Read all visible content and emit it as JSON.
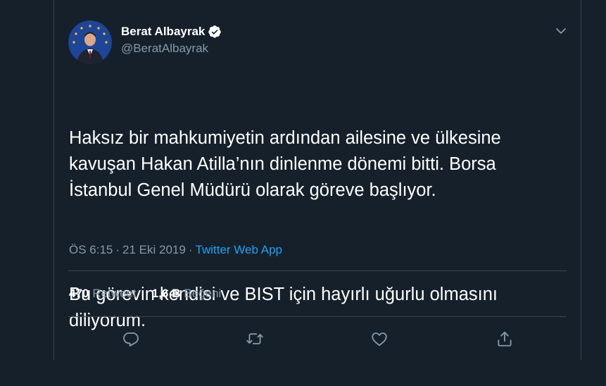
{
  "author": {
    "name": "Berat Albayrak",
    "handle": "@BeratAlbayrak",
    "verified": true
  },
  "tweet": {
    "paragraphs": [
      "Haksız bir mahkumiyetin ardından ailesine ve ülkesine\nkavuşan Hakan Atilla’nın dinlenme dönemi bitti. Borsa\nİstanbul Genel Müdürü olarak göreve başlıyor.",
      "Bu görevin kendisi ve BIST için hayırlı uğurlu olmasını\ndiliyorum."
    ]
  },
  "meta": {
    "time": "ÖS 6:15",
    "separator": "·",
    "date": "21 Eki 2019",
    "source": "Twitter Web App"
  },
  "stats": {
    "retweets_count": "470",
    "retweets_label": "Retweet",
    "likes_count": "1,6 B",
    "likes_label": "Beğeni"
  },
  "icons": {
    "reply": "reply-icon",
    "retweet": "retweet-icon",
    "like": "heart-icon",
    "share": "share-icon",
    "caret": "chevron-down-icon",
    "verified": "verified-badge-icon"
  },
  "colors": {
    "background": "#15202b",
    "border": "#38444d",
    "secondary_text": "#8899a6",
    "link": "#1da1f2",
    "icon": "#8899a6"
  }
}
